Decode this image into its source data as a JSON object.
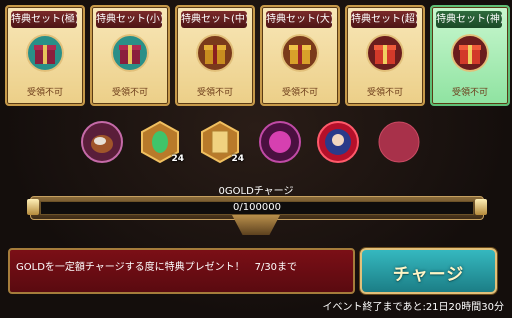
{
  "cards": [
    {
      "title": "特典セット(極)",
      "status": "受領不可",
      "active": false
    },
    {
      "title": "特典セット(小)",
      "status": "受領不可",
      "active": false
    },
    {
      "title": "特典セット(中)",
      "status": "受領不可",
      "active": false
    },
    {
      "title": "特典セット(大)",
      "status": "受領不可",
      "active": false
    },
    {
      "title": "特典セット(超)",
      "status": "受領不可",
      "active": false
    },
    {
      "title": "特典セット(神)",
      "status": "受領不可",
      "active": true
    }
  ],
  "items": [
    {
      "icon": "pet-food-icon",
      "count": ""
    },
    {
      "icon": "green-gem-icon",
      "count": "24"
    },
    {
      "icon": "gold-scroll-icon",
      "count": "24"
    },
    {
      "icon": "magenta-orb-icon",
      "count": ""
    },
    {
      "icon": "character-portrait-icon",
      "count": ""
    },
    {
      "icon": "empty-slot-icon",
      "count": ""
    }
  ],
  "progress": {
    "label": "0GOLDチャージ",
    "value_text": "0/100000",
    "current": 0,
    "max": 100000
  },
  "banner": {
    "text": "GOLDを一定額チャージする度に特典プレゼント！　7/30まで"
  },
  "charge_button": {
    "label": "チャージ"
  },
  "footer": {
    "time_left": "イベント終了まであと:21日20時間30分"
  },
  "colors": {
    "active_card": "#8fe3a1",
    "inactive_card": "#eccf88",
    "banner": "#7b0f16",
    "button": "#2aa0a8"
  }
}
